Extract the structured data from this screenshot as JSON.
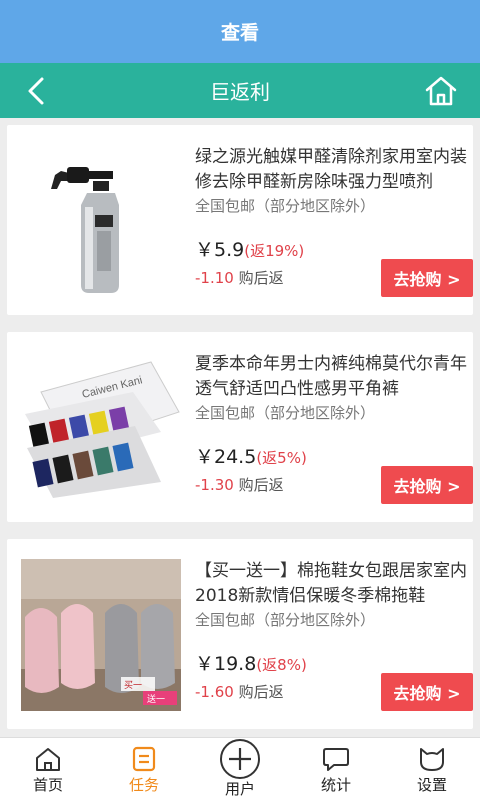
{
  "status_bar": {
    "title": "查看"
  },
  "nav": {
    "title": "巨返利",
    "back_icon": "chevron-left-icon",
    "home_icon": "home-icon"
  },
  "products": [
    {
      "title": "绿之源光触媒甲醛清除剂家用室内装修去除甲醛新房除味强力型喷剂",
      "shipping": "全国包邮（部分地区除外）",
      "price": "￥5.9",
      "rebate_rate": "(返19%)",
      "rebate_amount": "-1.10",
      "rebate_text": "购后返",
      "buy_label": "去抢购 >"
    },
    {
      "title": "夏季本命年男士内裤纯棉莫代尔青年透气舒适凹凸性感男平角裤",
      "shipping": "全国包邮（部分地区除外）",
      "price": "￥24.5",
      "rebate_rate": "(返5%)",
      "rebate_amount": "-1.30",
      "rebate_text": "购后返",
      "buy_label": "去抢购 >",
      "image_text": "Caiwen Kani"
    },
    {
      "title": "【买一送一】棉拖鞋女包跟居家室内2018新款情侣保暖冬季棉拖鞋",
      "shipping": "全国包邮（部分地区除外）",
      "price": "￥19.8",
      "rebate_rate": "(返8%)",
      "rebate_amount": "-1.60",
      "rebate_text": "购后返",
      "buy_label": "去抢购 >",
      "image_text_1": "买一",
      "image_text_2": "送一"
    }
  ],
  "tabbar": {
    "items": [
      {
        "label": "首页",
        "icon": "home-icon"
      },
      {
        "label": "任务",
        "icon": "task-icon",
        "active": true
      },
      {
        "label": "用户",
        "icon": "plus-circle-icon"
      },
      {
        "label": "统计",
        "icon": "chat-bubble-icon"
      },
      {
        "label": "设置",
        "icon": "cat-icon"
      }
    ],
    "active_color": "#f08a1b"
  },
  "colors": {
    "top_bar": "#5fa7e8",
    "nav_bar": "#2ab29c",
    "accent_red": "#ef4b4f"
  }
}
